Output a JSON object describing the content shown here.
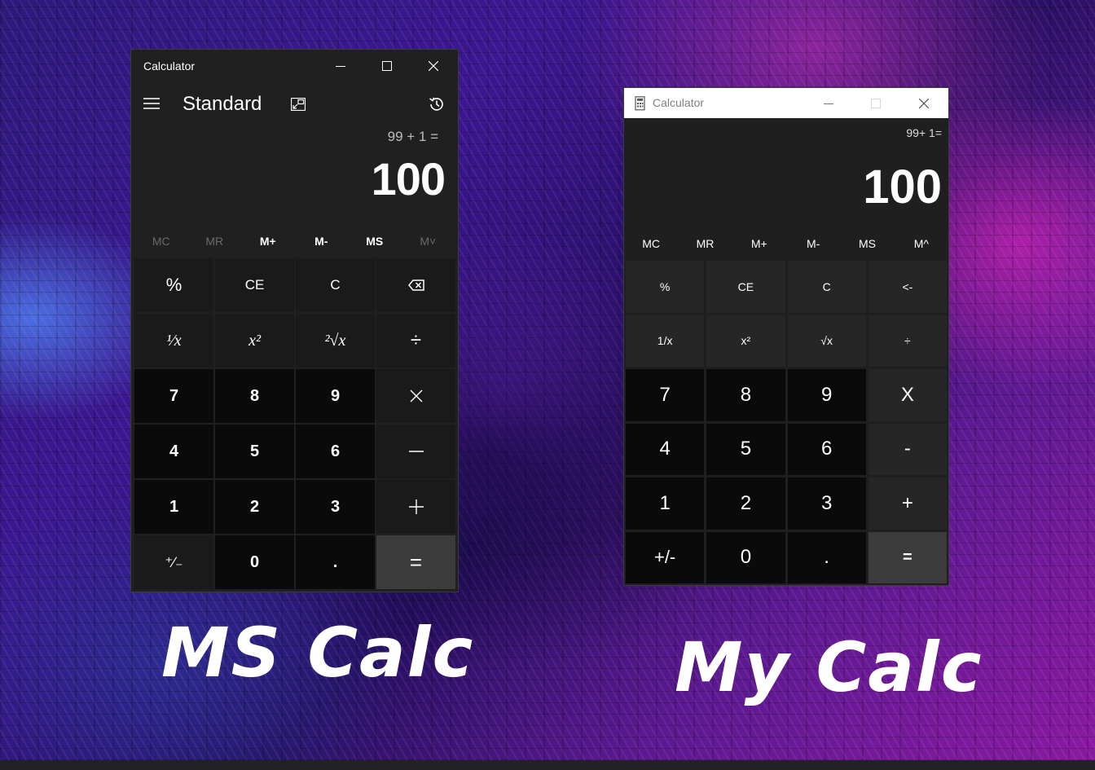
{
  "ms_calc": {
    "window_title": "Calculator",
    "mode": "Standard",
    "expression": "99 + 1 =",
    "result": "100",
    "memory": [
      {
        "label": "MC",
        "enabled": false
      },
      {
        "label": "MR",
        "enabled": false
      },
      {
        "label": "M+",
        "enabled": true
      },
      {
        "label": "M-",
        "enabled": true
      },
      {
        "label": "MS",
        "enabled": true
      },
      {
        "label": "M˅",
        "enabled": false
      }
    ],
    "keys": {
      "percent": "%",
      "ce": "CE",
      "c": "C",
      "reciprocal": "¹⁄x",
      "square": "x²",
      "sqrt": "²√x",
      "divide": "÷",
      "seven": "7",
      "eight": "8",
      "nine": "9",
      "four": "4",
      "five": "5",
      "six": "6",
      "one": "1",
      "two": "2",
      "three": "3",
      "negate": "⁺∕₋",
      "zero": "0",
      "decimal": ".",
      "equals": "="
    },
    "icons": {
      "menu": "hamburger-menu-icon",
      "keep_on_top": "keep-on-top-icon",
      "history": "history-icon",
      "backspace": "backspace-icon",
      "multiply": "multiply-icon",
      "minus": "minus-icon",
      "plus": "plus-icon"
    }
  },
  "my_calc": {
    "window_title": "Calculator",
    "expression": "99+ 1=",
    "result": "100",
    "memory": [
      "MC",
      "MR",
      "M+",
      "M-",
      "MS",
      "M^"
    ],
    "keys": {
      "percent": "%",
      "ce": "CE",
      "c": "C",
      "backspace": "<-",
      "reciprocal": "1/x",
      "square": "x²",
      "sqrt": "√x",
      "divide": "÷",
      "seven": "7",
      "eight": "8",
      "nine": "9",
      "multiply": "X",
      "four": "4",
      "five": "5",
      "six": "6",
      "minus": "-",
      "one": "1",
      "two": "2",
      "three": "3",
      "plus": "+",
      "negate": "+/-",
      "zero": "0",
      "decimal": ".",
      "equals": "="
    }
  },
  "captions": {
    "left": "MS Calc",
    "right": "My Calc"
  },
  "colors": {
    "window_bg": "#202020",
    "number_key_bg": "#0a0a0a",
    "operator_key_bg": "#1a1a1a",
    "equals_key_bg": "#3c3c3c",
    "my_titlebar_bg": "#ffffff"
  }
}
